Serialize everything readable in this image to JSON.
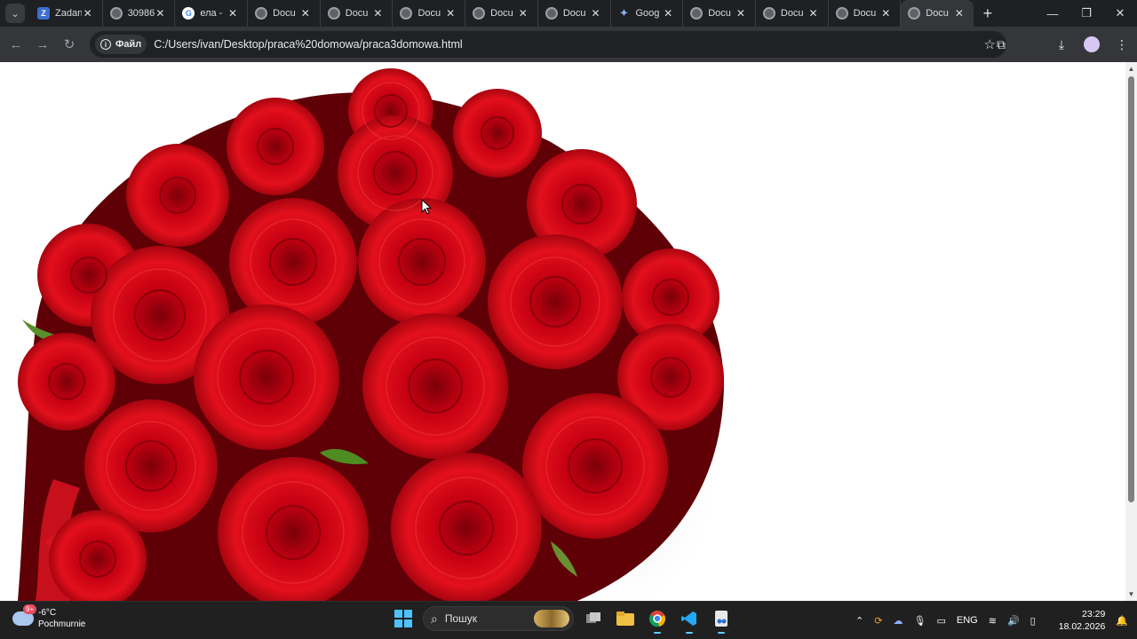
{
  "browser": {
    "tabs": [
      {
        "title": "Zadania",
        "icon": "zad-icon",
        "active": false
      },
      {
        "title": "30986",
        "icon": "globe-icon",
        "active": false
      },
      {
        "title": "ела -",
        "icon": "google-icon",
        "active": false
      },
      {
        "title": "Docu",
        "icon": "globe-icon",
        "active": false
      },
      {
        "title": "Docu",
        "icon": "globe-icon",
        "active": false
      },
      {
        "title": "Docu",
        "icon": "globe-icon",
        "active": false
      },
      {
        "title": "Docu",
        "icon": "globe-icon",
        "active": false
      },
      {
        "title": "Docu",
        "icon": "globe-icon",
        "active": false
      },
      {
        "title": "Goog",
        "icon": "gemini-icon",
        "active": false
      },
      {
        "title": "Docu",
        "icon": "globe-icon",
        "active": false
      },
      {
        "title": "Docu",
        "icon": "globe-icon",
        "active": false
      },
      {
        "title": "Docu",
        "icon": "globe-icon",
        "active": false
      },
      {
        "title": "Docu",
        "icon": "globe-icon",
        "active": true
      }
    ],
    "address": {
      "chip_label": "Файл",
      "url": "C:/Users/ivan/Desktop/praca%20domowa/praca3domowa.html"
    }
  },
  "page": {
    "image": "red-roses-bouquet"
  },
  "taskbar": {
    "weather_temp": "-6°C",
    "weather_desc": "Pochmurnie",
    "weather_badge": "9+",
    "search_placeholder": "Пошук",
    "language": "ENG",
    "time": "23:29",
    "date": "18.02.2026"
  }
}
